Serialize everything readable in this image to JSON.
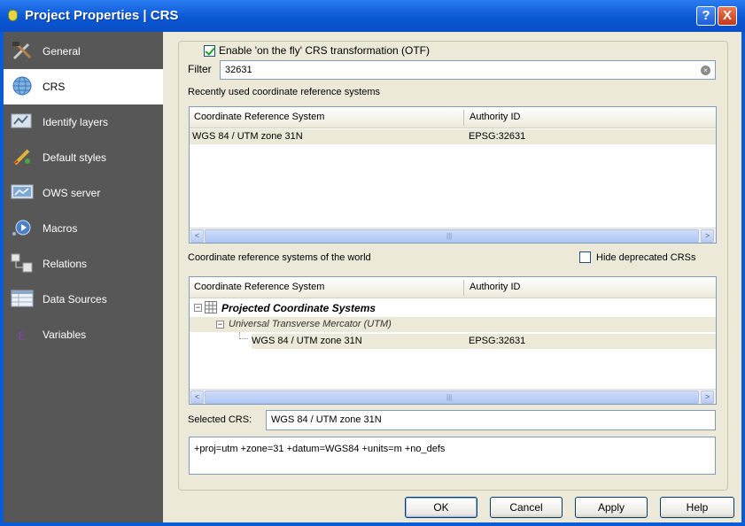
{
  "window": {
    "title": "Project Properties | CRS",
    "help_glyph": "?",
    "close_glyph": "X"
  },
  "sidebar": {
    "items": [
      {
        "label": "General",
        "icon": "wrench-hammer-icon"
      },
      {
        "label": "CRS",
        "icon": "globe-icon",
        "selected": true
      },
      {
        "label": "Identify layers",
        "icon": "identify-layers-icon"
      },
      {
        "label": "Default styles",
        "icon": "paint-brush-icon"
      },
      {
        "label": "OWS server",
        "icon": "ows-server-icon"
      },
      {
        "label": "Macros",
        "icon": "macro-play-icon"
      },
      {
        "label": "Relations",
        "icon": "relations-icon"
      },
      {
        "label": "Data Sources",
        "icon": "data-sources-table-icon"
      },
      {
        "label": "Variables",
        "icon": "variables-epsilon-icon"
      }
    ]
  },
  "crs": {
    "otf_label": "Enable 'on the fly' CRS transformation (OTF)",
    "otf_checked": true,
    "filter_label": "Filter",
    "filter_value": "32631",
    "recent_label": "Recently used coordinate reference systems",
    "recent_table": {
      "headers": [
        "Coordinate Reference System",
        "Authority ID"
      ],
      "rows": [
        {
          "crs": "WGS 84 / UTM zone 31N",
          "authority": "EPSG:32631"
        }
      ]
    },
    "world_label": "Coordinate reference systems of the world",
    "hide_deprecated_label": "Hide deprecated CRSs",
    "world_table": {
      "headers": [
        "Coordinate Reference System",
        "Authority ID"
      ],
      "tree": {
        "root": "Projected Coordinate Systems",
        "child": "Universal Transverse Mercator (UTM)",
        "leaf": {
          "crs": "WGS 84 / UTM zone 31N",
          "authority": "EPSG:32631"
        }
      }
    },
    "selected_label": "Selected CRS:",
    "selected_value": "WGS 84 / UTM zone 31N",
    "proj_string": "+proj=utm +zone=31 +datum=WGS84 +units=m +no_defs",
    "scroll_grip": "|||",
    "scroll_left": "<",
    "scroll_right": ">"
  },
  "buttons": {
    "ok": "OK",
    "cancel": "Cancel",
    "apply": "Apply",
    "help": "Help"
  },
  "colors": {
    "title_bar": "#0a57d4",
    "sidebar_bg": "#575757",
    "dialog_bg": "#ece9d8",
    "selection": "#ece9d8"
  }
}
